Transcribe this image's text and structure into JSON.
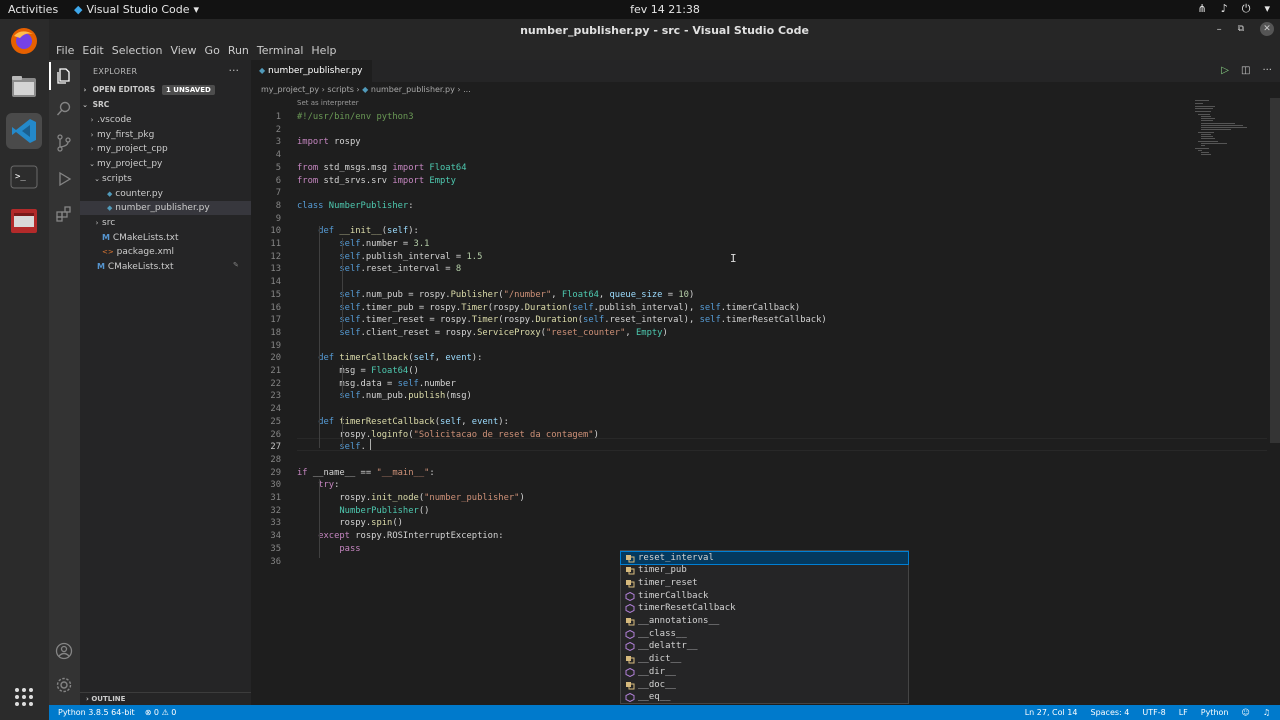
{
  "topbar": {
    "activities": "Activities",
    "app_name": "Visual Studio Code",
    "clock": "fev 14  21:38"
  },
  "window": {
    "title": "number_publisher.py - src - Visual Studio Code"
  },
  "menu": [
    "File",
    "Edit",
    "Selection",
    "View",
    "Go",
    "Run",
    "Terminal",
    "Help"
  ],
  "explorer": {
    "header": "EXPLORER",
    "open_editors": "OPEN EDITORS",
    "unsaved_badge": "1 UNSAVED",
    "root": "SRC",
    "tree": [
      {
        "label": ".vscode",
        "chev": "›",
        "indent": 1,
        "icon": "folder",
        "selected": false
      },
      {
        "label": "my_first_pkg",
        "chev": "›",
        "indent": 1,
        "icon": "folder",
        "selected": false
      },
      {
        "label": "my_project_cpp",
        "chev": "›",
        "indent": 1,
        "icon": "folder",
        "selected": false
      },
      {
        "label": "my_project_py",
        "chev": "⌄",
        "indent": 1,
        "icon": "folder",
        "selected": false
      },
      {
        "label": "scripts",
        "chev": "⌄",
        "indent": 2,
        "icon": "folder",
        "selected": false
      },
      {
        "label": "counter.py",
        "chev": "",
        "indent": 3,
        "icon": "python",
        "selected": false
      },
      {
        "label": "number_publisher.py",
        "chev": "",
        "indent": 3,
        "icon": "python",
        "selected": true
      },
      {
        "label": "src",
        "chev": "›",
        "indent": 2,
        "icon": "folder",
        "selected": false
      },
      {
        "label": "CMakeLists.txt",
        "chev": "",
        "indent": 2,
        "icon": "cmake",
        "selected": false
      },
      {
        "label": "package.xml",
        "chev": "",
        "indent": 2,
        "icon": "xml",
        "selected": false
      },
      {
        "label": "CMakeLists.txt",
        "chev": "",
        "indent": 1,
        "icon": "cmake",
        "selected": false
      }
    ],
    "outline": "OUTLINE"
  },
  "tab": {
    "filename": "number_publisher.py"
  },
  "breadcrumb": [
    "my_project_py",
    "scripts",
    "number_publisher.py",
    "..."
  ],
  "codelens": "Set as interpreter",
  "current_line": 27,
  "suggestions": [
    {
      "label": "reset_interval",
      "icon": "field",
      "selected": true
    },
    {
      "label": "timer_pub",
      "icon": "field",
      "selected": false
    },
    {
      "label": "timer_reset",
      "icon": "field",
      "selected": false
    },
    {
      "label": "timerCallback",
      "icon": "method",
      "selected": false
    },
    {
      "label": "timerResetCallback",
      "icon": "method",
      "selected": false
    },
    {
      "label": "__annotations__",
      "icon": "field",
      "selected": false
    },
    {
      "label": "__class__",
      "icon": "method",
      "selected": false
    },
    {
      "label": "__delattr__",
      "icon": "method",
      "selected": false
    },
    {
      "label": "__dict__",
      "icon": "field",
      "selected": false
    },
    {
      "label": "__dir__",
      "icon": "method",
      "selected": false
    },
    {
      "label": "__doc__",
      "icon": "field",
      "selected": false
    },
    {
      "label": "__eq__",
      "icon": "method",
      "selected": false
    }
  ],
  "statusbar": {
    "interpreter": "Python 3.8.5 64-bit",
    "problems": "⊗ 0 ⚠ 0",
    "position": "Ln 27, Col 14",
    "spaces": "Spaces: 4",
    "encoding": "UTF-8",
    "eol": "LF",
    "language": "Python"
  },
  "colors": {
    "accent": "#007acc",
    "editor_bg": "#1e1e1e",
    "sidebar_bg": "#252526"
  }
}
